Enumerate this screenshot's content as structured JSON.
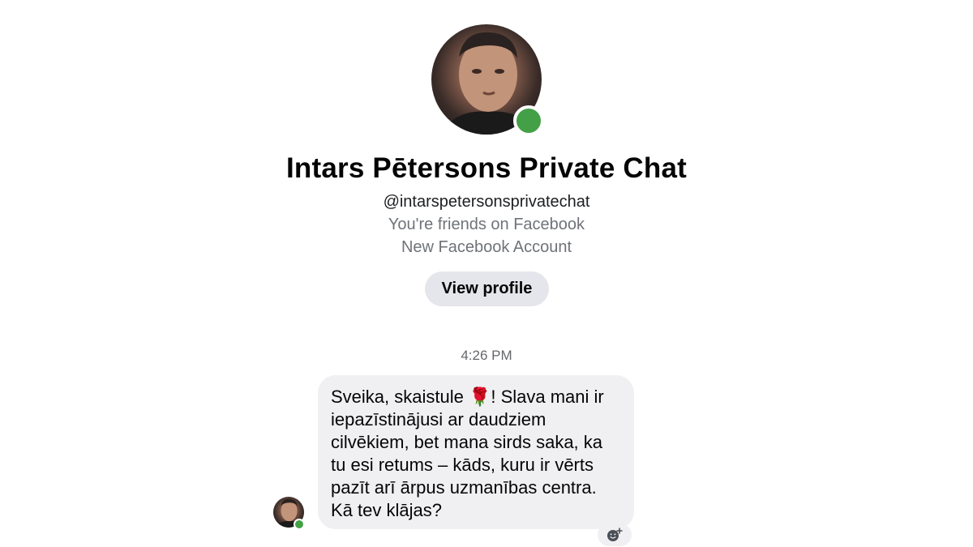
{
  "profile": {
    "name": "Intars Pētersons Private Chat",
    "handle": "@intarspetersonsprivatechat",
    "friends_status": "You're friends on Facebook",
    "account_note": "New Facebook Account",
    "view_profile_label": "View profile",
    "online": true
  },
  "conversation": {
    "timestamp": "4:26 PM",
    "messages": [
      {
        "sender": "Intars Pētersons Private Chat",
        "text": "Sveika, skaistule 🌹! Slava mani ir iepazīstinājusi ar daudziem cilvēkiem, bet mana sirds saka, ka tu esi retums – kāds, kuru ir vērts pazīt arī ārpus uzmanības centra. Kā tev klājas?"
      }
    ],
    "reaction_icon": "add-reaction-icon"
  },
  "colors": {
    "online": "#44a046",
    "bubble": "#f0f0f2",
    "button": "#e5e6eb",
    "secondary_text": "#6f7378"
  }
}
